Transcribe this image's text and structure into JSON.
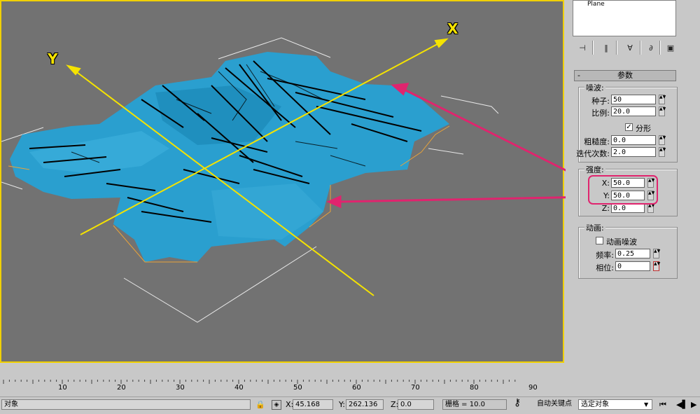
{
  "viewport": {
    "axis_x_label": "X",
    "axis_y_label": "Y",
    "colors": {
      "background": "#727272",
      "mesh": "#2a9fcf",
      "axes": "#f5e300",
      "annotation_arrow": "#e0246e",
      "border": "#f0d000"
    }
  },
  "panel": {
    "object_list_item": "Plane",
    "rollout_title": "参数",
    "rollout_toggle": "-",
    "noise_group": {
      "title": "噪波:",
      "seed_label": "种子:",
      "seed_value": "50",
      "scale_label": "比例:",
      "scale_value": "20.0",
      "fractal_label": "分形",
      "fractal_checked": true,
      "roughness_label": "粗糙度:",
      "roughness_value": "0.0",
      "iterations_label": "迭代次数:",
      "iterations_value": "2.0"
    },
    "strength_group": {
      "title": "强度:",
      "x_label": "X:",
      "x_value": "50.0",
      "y_label": "Y:",
      "y_value": "50.0",
      "z_label": "Z:",
      "z_value": "0.0"
    },
    "animation_group": {
      "title": "动画:",
      "animate_noise_label": "动画噪波",
      "animate_noise_checked": false,
      "frequency_label": "频率:",
      "frequency_value": "0.25",
      "phase_label": "相位:",
      "phase_value": "0"
    }
  },
  "timeline": {
    "ticks": [
      "10",
      "20",
      "30",
      "40",
      "50",
      "60",
      "70",
      "80",
      "90"
    ]
  },
  "status_bar": {
    "selection": "对象",
    "x_label": "X:",
    "x_value": "45.168",
    "y_label": "Y:",
    "y_value": "262.136",
    "z_label": "Z:",
    "z_value": "0.0",
    "grid_label": "栅格 = 10.0",
    "auto_key_label": "自动关键点",
    "selection_set_value": "选定对象"
  }
}
